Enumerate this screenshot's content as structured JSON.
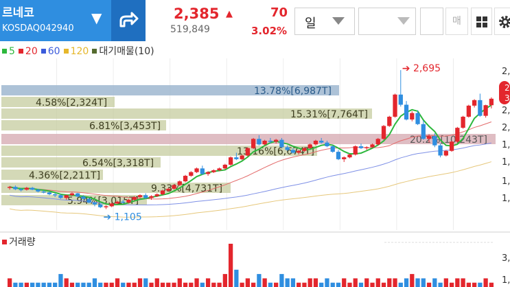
{
  "header": {
    "stock_name": "르네코",
    "market_code": "KOSDAQ042940",
    "price": "2,385",
    "volume": "519,849",
    "change": "70",
    "change_pct": "3.02%",
    "period_select": "일",
    "trade_button": "매"
  },
  "legend": {
    "ma": [
      {
        "label": "5",
        "color": "#2db83d"
      },
      {
        "label": "20",
        "color": "#e3262d"
      },
      {
        "label": "60",
        "color": "#3b5bdb"
      },
      {
        "label": "120",
        "color": "#e6b72b"
      }
    ],
    "supply": {
      "label": "대기매물(10)",
      "color": "#556b2f"
    }
  },
  "volume_legend": {
    "label": "거래량",
    "color": "#e3262d"
  },
  "chart_data": {
    "type": "candlestick",
    "max_label": "2,695",
    "min_label": "1,105",
    "price_axis_right": [
      "2,",
      "2,",
      "2,",
      "2,",
      "1,",
      "1,",
      "1,",
      "1,"
    ],
    "volume_axis_right": [
      "3,",
      "1,"
    ],
    "volume_profile": [
      {
        "label": "13.78%[6,987T]",
        "pct": 13.78,
        "highlight": "blue"
      },
      {
        "label": "4.58%[2,324T]",
        "pct": 4.58
      },
      {
        "label": "15.31%[7,764T]",
        "pct": 15.31
      },
      {
        "label": "6.81%[3,453T]",
        "pct": 6.81
      },
      {
        "label": "20.2%[10,243T]",
        "pct": 20.2,
        "highlight": "red"
      },
      {
        "label": "13.16%[6,674T]",
        "pct": 13.16
      },
      {
        "label": "6.54%[3,318T]",
        "pct": 6.54
      },
      {
        "label": "4.36%[2,211T]",
        "pct": 4.36
      },
      {
        "label": "9.33%[4,731T]",
        "pct": 9.33
      },
      {
        "label": "5.94%[3,015T]",
        "pct": 5.94
      }
    ],
    "candles": [
      [
        1420,
        1440,
        1400,
        1430
      ],
      [
        1430,
        1445,
        1395,
        1405
      ],
      [
        1405,
        1420,
        1380,
        1400
      ],
      [
        1400,
        1430,
        1390,
        1420
      ],
      [
        1420,
        1430,
        1395,
        1400
      ],
      [
        1400,
        1410,
        1370,
        1380
      ],
      [
        1380,
        1395,
        1360,
        1370
      ],
      [
        1370,
        1380,
        1340,
        1350
      ],
      [
        1350,
        1365,
        1320,
        1340
      ],
      [
        1340,
        1350,
        1300,
        1310
      ],
      [
        1310,
        1345,
        1290,
        1340
      ],
      [
        1340,
        1370,
        1330,
        1360
      ],
      [
        1360,
        1365,
        1320,
        1325
      ],
      [
        1325,
        1340,
        1290,
        1300
      ],
      [
        1300,
        1310,
        1250,
        1260
      ],
      [
        1260,
        1270,
        1220,
        1240
      ],
      [
        1240,
        1250,
        1200,
        1210
      ],
      [
        1210,
        1230,
        1190,
        1220
      ],
      [
        1220,
        1260,
        1210,
        1250
      ],
      [
        1250,
        1280,
        1240,
        1270
      ],
      [
        1270,
        1290,
        1250,
        1260
      ],
      [
        1260,
        1300,
        1250,
        1290
      ],
      [
        1290,
        1330,
        1280,
        1320
      ],
      [
        1320,
        1350,
        1310,
        1340
      ],
      [
        1340,
        1360,
        1300,
        1310
      ],
      [
        1310,
        1340,
        1290,
        1330
      ],
      [
        1330,
        1360,
        1320,
        1350
      ],
      [
        1350,
        1400,
        1340,
        1390
      ],
      [
        1390,
        1420,
        1380,
        1410
      ],
      [
        1410,
        1460,
        1400,
        1450
      ],
      [
        1450,
        1500,
        1440,
        1490
      ],
      [
        1490,
        1560,
        1480,
        1550
      ],
      [
        1550,
        1600,
        1540,
        1590
      ],
      [
        1590,
        1640,
        1580,
        1630
      ],
      [
        1630,
        1660,
        1560,
        1570
      ],
      [
        1570,
        1600,
        1550,
        1590
      ],
      [
        1590,
        1620,
        1580,
        1610
      ],
      [
        1610,
        1640,
        1600,
        1630
      ],
      [
        1630,
        1680,
        1620,
        1670
      ],
      [
        1670,
        1760,
        1660,
        1750
      ],
      [
        1750,
        1800,
        1720,
        1730
      ],
      [
        1730,
        1780,
        1720,
        1770
      ],
      [
        1770,
        1860,
        1760,
        1850
      ],
      [
        1850,
        1960,
        1840,
        1950
      ],
      [
        1950,
        1990,
        1880,
        1890
      ],
      [
        1890,
        1940,
        1880,
        1930
      ],
      [
        1930,
        1960,
        1900,
        1920
      ],
      [
        1920,
        1950,
        1900,
        1940
      ],
      [
        1940,
        1960,
        1850,
        1860
      ],
      [
        1860,
        1880,
        1820,
        1830
      ],
      [
        1830,
        1850,
        1790,
        1800
      ],
      [
        1800,
        1830,
        1780,
        1820
      ],
      [
        1820,
        1860,
        1810,
        1850
      ],
      [
        1850,
        1900,
        1840,
        1890
      ],
      [
        1890,
        1940,
        1880,
        1930
      ],
      [
        1930,
        1960,
        1900,
        1910
      ],
      [
        1910,
        1930,
        1860,
        1870
      ],
      [
        1870,
        1880,
        1800,
        1810
      ],
      [
        1810,
        1830,
        1720,
        1730
      ],
      [
        1730,
        1760,
        1700,
        1750
      ],
      [
        1750,
        1790,
        1740,
        1780
      ],
      [
        1780,
        1880,
        1770,
        1870
      ],
      [
        1870,
        1900,
        1840,
        1850
      ],
      [
        1850,
        1870,
        1830,
        1860
      ],
      [
        1860,
        1900,
        1850,
        1890
      ],
      [
        1890,
        1960,
        1880,
        1950
      ],
      [
        1950,
        2100,
        1940,
        2090
      ],
      [
        2090,
        2200,
        2080,
        2190
      ],
      [
        2190,
        2440,
        2180,
        2430
      ],
      [
        2430,
        2695,
        2300,
        2320
      ],
      [
        2320,
        2360,
        2150,
        2160
      ],
      [
        2160,
        2250,
        2140,
        2230
      ],
      [
        2230,
        2260,
        2100,
        2110
      ],
      [
        2110,
        2150,
        1940,
        1950
      ],
      [
        1950,
        2000,
        1910,
        1980
      ],
      [
        1980,
        2010,
        1860,
        1880
      ],
      [
        1880,
        1900,
        1750,
        1770
      ],
      [
        1770,
        1830,
        1760,
        1820
      ],
      [
        1820,
        1930,
        1810,
        1920
      ],
      [
        1920,
        2080,
        1910,
        2070
      ],
      [
        2070,
        2200,
        2060,
        2190
      ],
      [
        2190,
        2320,
        2180,
        2310
      ],
      [
        2310,
        2380,
        2290,
        2370
      ],
      [
        2370,
        2440,
        2190,
        2200
      ],
      [
        2200,
        2320,
        2180,
        2315
      ],
      [
        2315,
        2400,
        2280,
        2385
      ]
    ],
    "volumes": [
      2,
      1,
      1,
      1,
      1,
      1,
      1,
      1,
      1,
      3,
      2,
      1,
      1,
      1,
      1,
      2,
      1,
      1,
      1,
      2,
      1,
      1,
      1,
      2,
      2,
      1,
      2,
      1,
      1,
      1,
      2,
      1,
      1,
      2,
      1,
      2,
      1,
      1,
      3,
      10,
      4,
      1,
      2,
      1,
      3,
      2,
      1,
      1,
      3,
      2,
      2,
      1,
      1,
      2,
      2,
      1,
      2,
      1,
      1,
      2,
      1,
      2,
      1,
      2,
      1,
      2,
      1,
      2,
      2,
      1,
      2,
      3,
      2,
      2,
      1,
      2,
      1,
      2,
      1,
      2,
      2,
      1,
      1,
      1,
      2,
      1
    ],
    "vol_up_color": "#e3262d",
    "vol_down_color": "#2f8ee0"
  }
}
